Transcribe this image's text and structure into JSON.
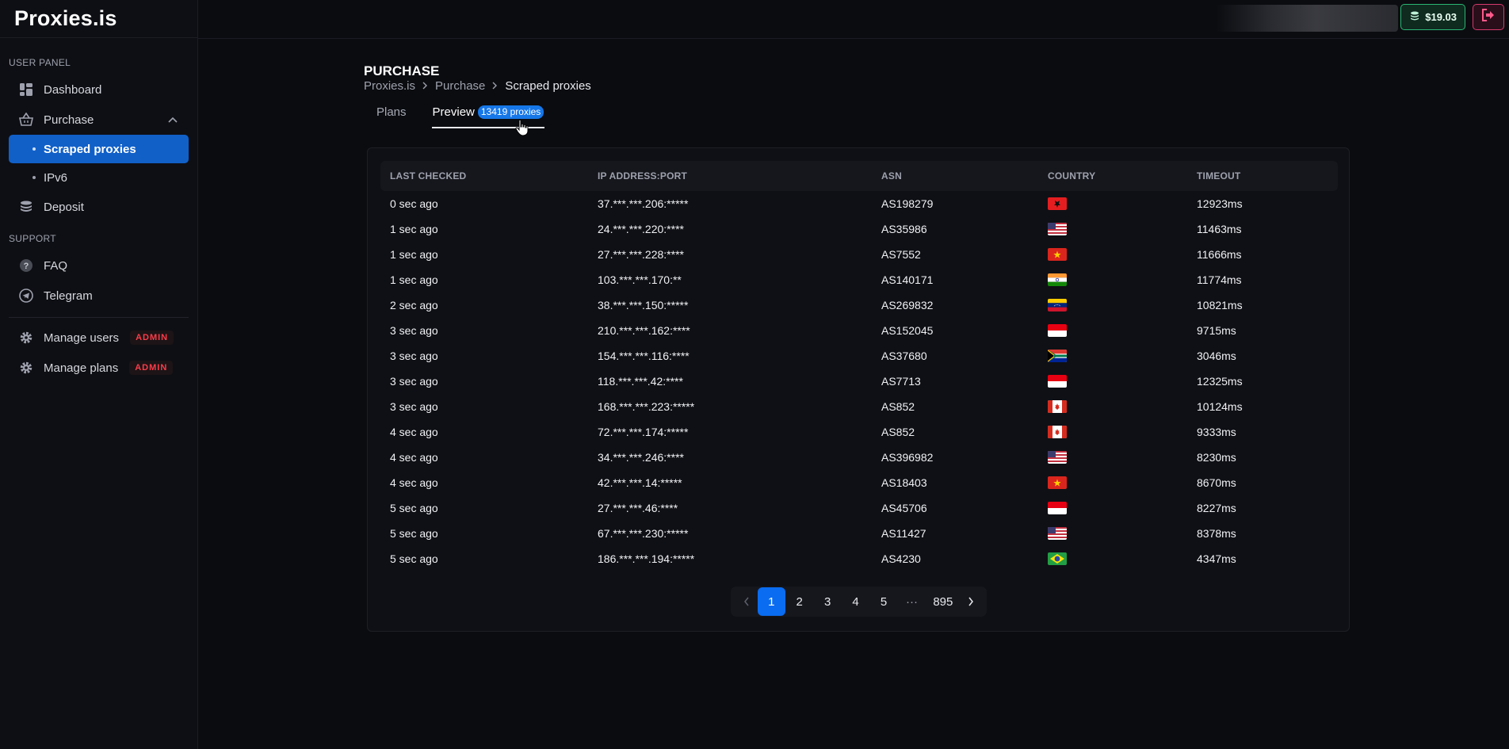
{
  "brand": {
    "name": "Proxies.is"
  },
  "sidebar": {
    "section_user": "USER PANEL",
    "dashboard": "Dashboard",
    "purchase": "Purchase",
    "purchase_sub": [
      "Scraped proxies",
      "IPv6"
    ],
    "deposit": "Deposit",
    "section_support": "SUPPORT",
    "faq": "FAQ",
    "telegram": "Telegram",
    "manage_users": "Manage users",
    "manage_plans": "Manage plans",
    "admin_badge": "ADMIN"
  },
  "topbar": {
    "balance": "$19.03"
  },
  "page": {
    "title": "PURCHASE",
    "breadcrumb": [
      "Proxies.is",
      "Purchase",
      "Scraped proxies"
    ],
    "tabs": {
      "plans": "Plans",
      "preview": "Preview",
      "preview_badge": "13419 proxies"
    }
  },
  "table": {
    "headers": [
      "LAST CHECKED",
      "IP ADDRESS:PORT",
      "ASN",
      "COUNTRY",
      "TIMEOUT"
    ],
    "rows": [
      {
        "checked": "0 sec ago",
        "ip": "37.***.***.206:*****",
        "asn": "AS198279",
        "flag": "al",
        "timeout": "12923ms"
      },
      {
        "checked": "1 sec ago",
        "ip": "24.***.***.220:****",
        "asn": "AS35986",
        "flag": "us",
        "timeout": "11463ms"
      },
      {
        "checked": "1 sec ago",
        "ip": "27.***.***.228:****",
        "asn": "AS7552",
        "flag": "vn",
        "timeout": "11666ms"
      },
      {
        "checked": "1 sec ago",
        "ip": "103.***.***.170:**",
        "asn": "AS140171",
        "flag": "in",
        "timeout": "11774ms"
      },
      {
        "checked": "2 sec ago",
        "ip": "38.***.***.150:*****",
        "asn": "AS269832",
        "flag": "ve",
        "timeout": "10821ms"
      },
      {
        "checked": "3 sec ago",
        "ip": "210.***.***.162:****",
        "asn": "AS152045",
        "flag": "id",
        "timeout": "9715ms"
      },
      {
        "checked": "3 sec ago",
        "ip": "154.***.***.116:****",
        "asn": "AS37680",
        "flag": "za",
        "timeout": "3046ms"
      },
      {
        "checked": "3 sec ago",
        "ip": "118.***.***.42:****",
        "asn": "AS7713",
        "flag": "id",
        "timeout": "12325ms"
      },
      {
        "checked": "3 sec ago",
        "ip": "168.***.***.223:*****",
        "asn": "AS852",
        "flag": "ca",
        "timeout": "10124ms"
      },
      {
        "checked": "4 sec ago",
        "ip": "72.***.***.174:*****",
        "asn": "AS852",
        "flag": "ca",
        "timeout": "9333ms"
      },
      {
        "checked": "4 sec ago",
        "ip": "34.***.***.246:****",
        "asn": "AS396982",
        "flag": "us",
        "timeout": "8230ms"
      },
      {
        "checked": "4 sec ago",
        "ip": "42.***.***.14:*****",
        "asn": "AS18403",
        "flag": "vn",
        "timeout": "8670ms"
      },
      {
        "checked": "5 sec ago",
        "ip": "27.***.***.46:****",
        "asn": "AS45706",
        "flag": "id",
        "timeout": "8227ms"
      },
      {
        "checked": "5 sec ago",
        "ip": "67.***.***.230:*****",
        "asn": "AS11427",
        "flag": "us",
        "timeout": "8378ms"
      },
      {
        "checked": "5 sec ago",
        "ip": "186.***.***.194:*****",
        "asn": "AS4230",
        "flag": "br",
        "timeout": "4347ms"
      }
    ]
  },
  "pagination": {
    "pages": [
      "1",
      "2",
      "3",
      "4",
      "5"
    ],
    "ellipsis": "···",
    "last": "895",
    "current": "1"
  }
}
